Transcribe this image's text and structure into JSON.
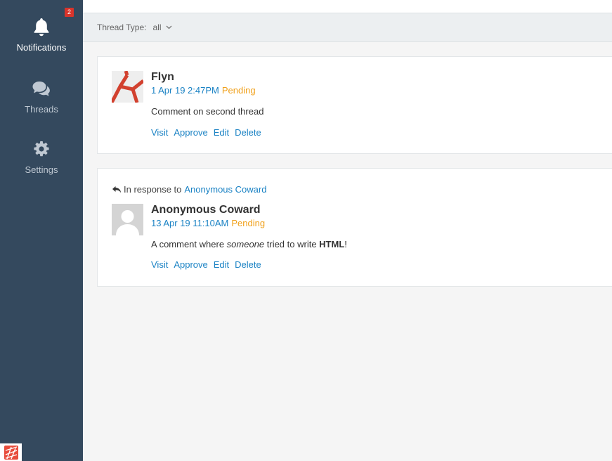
{
  "sidebar": {
    "items": [
      {
        "label": "Notifications",
        "icon": "bell-icon",
        "active": true,
        "badge": "2"
      },
      {
        "label": "Threads",
        "icon": "comments-icon",
        "active": false
      },
      {
        "label": "Settings",
        "icon": "gear-icon",
        "active": false
      }
    ]
  },
  "filter": {
    "label": "Thread Type:",
    "value": "all"
  },
  "comments": [
    {
      "author": "Flyn",
      "date": "1 Apr 19 2:47PM",
      "status": "Pending",
      "body": "Comment on second thread",
      "actions": [
        "Visit",
        "Approve",
        "Edit",
        "Delete"
      ]
    },
    {
      "in_response_label": "In response to",
      "in_response_to": "Anonymous Coward",
      "author": "Anonymous Coward",
      "date": "13 Apr 19 11:10AM",
      "status": "Pending",
      "body_parts": [
        "A comment where ",
        "someone",
        " tried to write ",
        "HTML",
        "!"
      ],
      "actions": [
        "Visit",
        "Approve",
        "Edit",
        "Delete"
      ]
    }
  ],
  "colors": {
    "sidebar": "#34495e",
    "link": "#1a82c4",
    "pending": "#f0a01a",
    "badge": "#d9342b"
  }
}
